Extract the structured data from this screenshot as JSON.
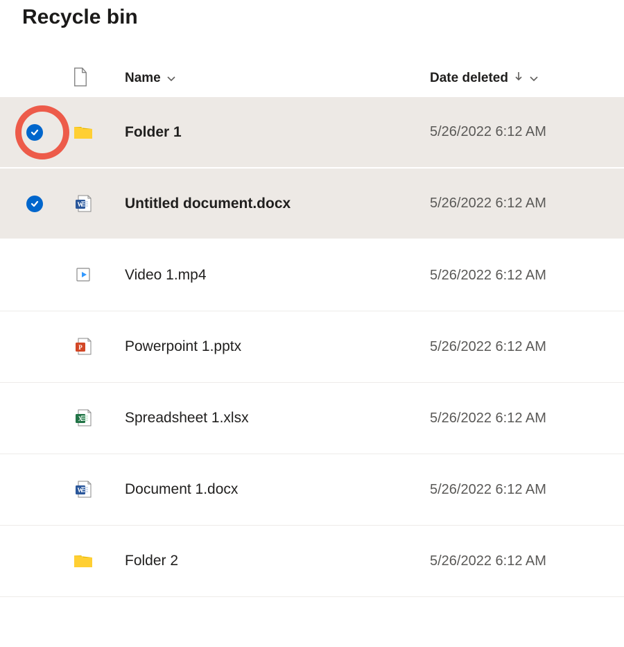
{
  "page_title": "Recycle bin",
  "columns": {
    "name_label": "Name",
    "date_label": "Date deleted"
  },
  "items": [
    {
      "name": "Folder 1",
      "date": "5/26/2022 6:12 AM",
      "icon": "folder",
      "selected": true,
      "highlighted": true
    },
    {
      "name": "Untitled document.docx",
      "date": "5/26/2022 6:12 AM",
      "icon": "word",
      "selected": true,
      "highlighted": false
    },
    {
      "name": "Video 1.mp4",
      "date": "5/26/2022 6:12 AM",
      "icon": "video",
      "selected": false,
      "highlighted": false
    },
    {
      "name": "Powerpoint 1.pptx",
      "date": "5/26/2022 6:12 AM",
      "icon": "powerpoint",
      "selected": false,
      "highlighted": false
    },
    {
      "name": "Spreadsheet 1.xlsx",
      "date": "5/26/2022 6:12 AM",
      "icon": "excel",
      "selected": false,
      "highlighted": false
    },
    {
      "name": "Document 1.docx",
      "date": "5/26/2022 6:12 AM",
      "icon": "word",
      "selected": false,
      "highlighted": false
    },
    {
      "name": "Folder 2",
      "date": "5/26/2022 6:12 AM",
      "icon": "folder",
      "selected": false,
      "highlighted": false
    }
  ]
}
